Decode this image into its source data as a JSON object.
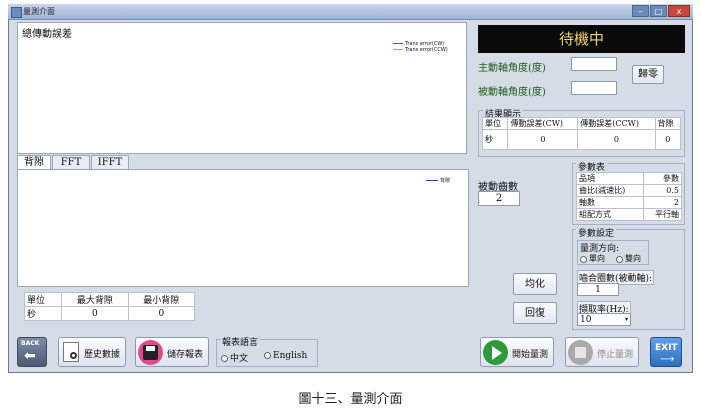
{
  "window": {
    "title": "量測介面"
  },
  "transmission_error": {
    "title": "總傳動誤差",
    "legend": [
      "Trans error(CW)",
      "Trans error(CCW)"
    ],
    "legend_colors": [
      "#1f6fd0",
      "#e0a020"
    ]
  },
  "status": {
    "text": "待機中"
  },
  "angles": {
    "master_label": "主動軸角度(度)",
    "master_value": "",
    "driven_label": "被動軸角度(度)",
    "driven_value": "",
    "reset_label": "歸零"
  },
  "results": {
    "title": "結果顯示",
    "headers": [
      "單位",
      "傳動誤差(CW)",
      "傳動誤差(CCW)",
      "背隙"
    ],
    "row": [
      "秒",
      "0",
      "0",
      "0"
    ]
  },
  "tabs": [
    "背隙",
    "FFT",
    "IFFT"
  ],
  "backlash_chart": {
    "legend": "背隙",
    "legend_color": "#2a4f8a"
  },
  "driven_teeth": {
    "label": "被動齒數",
    "value": "2"
  },
  "backlash_stats": {
    "headers": [
      "單位",
      "最大背隙",
      "最小背隙"
    ],
    "row": [
      "秒",
      "0",
      "0"
    ]
  },
  "buttons": {
    "average": "均化",
    "restore": "回復",
    "back": "BACK",
    "history": "歷史數據",
    "save_report": "儲存報表",
    "start": "開始量測",
    "stop": "停止量測",
    "exit": "EXIT"
  },
  "params_table": {
    "title": "參數表",
    "headers": [
      "品項",
      "參數"
    ],
    "rows": [
      [
        "齒比(減速比)",
        "0.5"
      ],
      [
        "軸數",
        "2"
      ],
      [
        "組配方式",
        "平行軸"
      ]
    ]
  },
  "settings": {
    "title": "參數設定",
    "direction_label": "量測方向:",
    "direction_options": [
      "單向",
      "雙向"
    ],
    "mesh_label": "嚙合圈數(被動軸):",
    "mesh_value": "1",
    "sample_label": "擷取率(Hz):",
    "sample_value": "10"
  },
  "language": {
    "title": "報表語言",
    "options": [
      "中文",
      "English"
    ]
  },
  "caption": "圖十三、量測介面"
}
